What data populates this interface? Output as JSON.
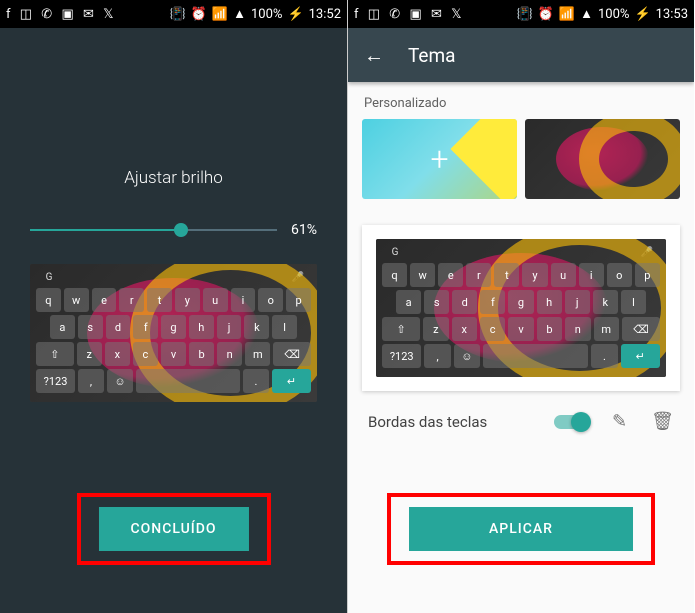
{
  "left": {
    "status": {
      "battery": "100%",
      "time": "13:52"
    },
    "brightness_title": "Ajustar brilho",
    "brightness_pct": "61%",
    "done_btn": "CONCLUÍDO"
  },
  "right": {
    "status": {
      "battery": "100%",
      "time": "13:53"
    },
    "appbar_title": "Tema",
    "section_label": "Personalizado",
    "add_theme": "+",
    "toggle_label": "Bordas das teclas",
    "apply_btn": "APLICAR"
  },
  "keyboard": {
    "row1": [
      "q",
      "w",
      "e",
      "r",
      "t",
      "y",
      "u",
      "i",
      "o",
      "p"
    ],
    "row2": [
      "a",
      "s",
      "d",
      "f",
      "g",
      "h",
      "j",
      "k",
      "l"
    ],
    "row3_shift": "⇧",
    "row3": [
      "z",
      "x",
      "c",
      "v",
      "b",
      "n",
      "m"
    ],
    "row3_del": "⌫",
    "row4_sym": "?123",
    "row4_comma": ",",
    "row4_emoji": "☺",
    "row4_dot": ".",
    "row4_enter": "↵",
    "top_g": "G",
    "top_mic": "🎤"
  }
}
